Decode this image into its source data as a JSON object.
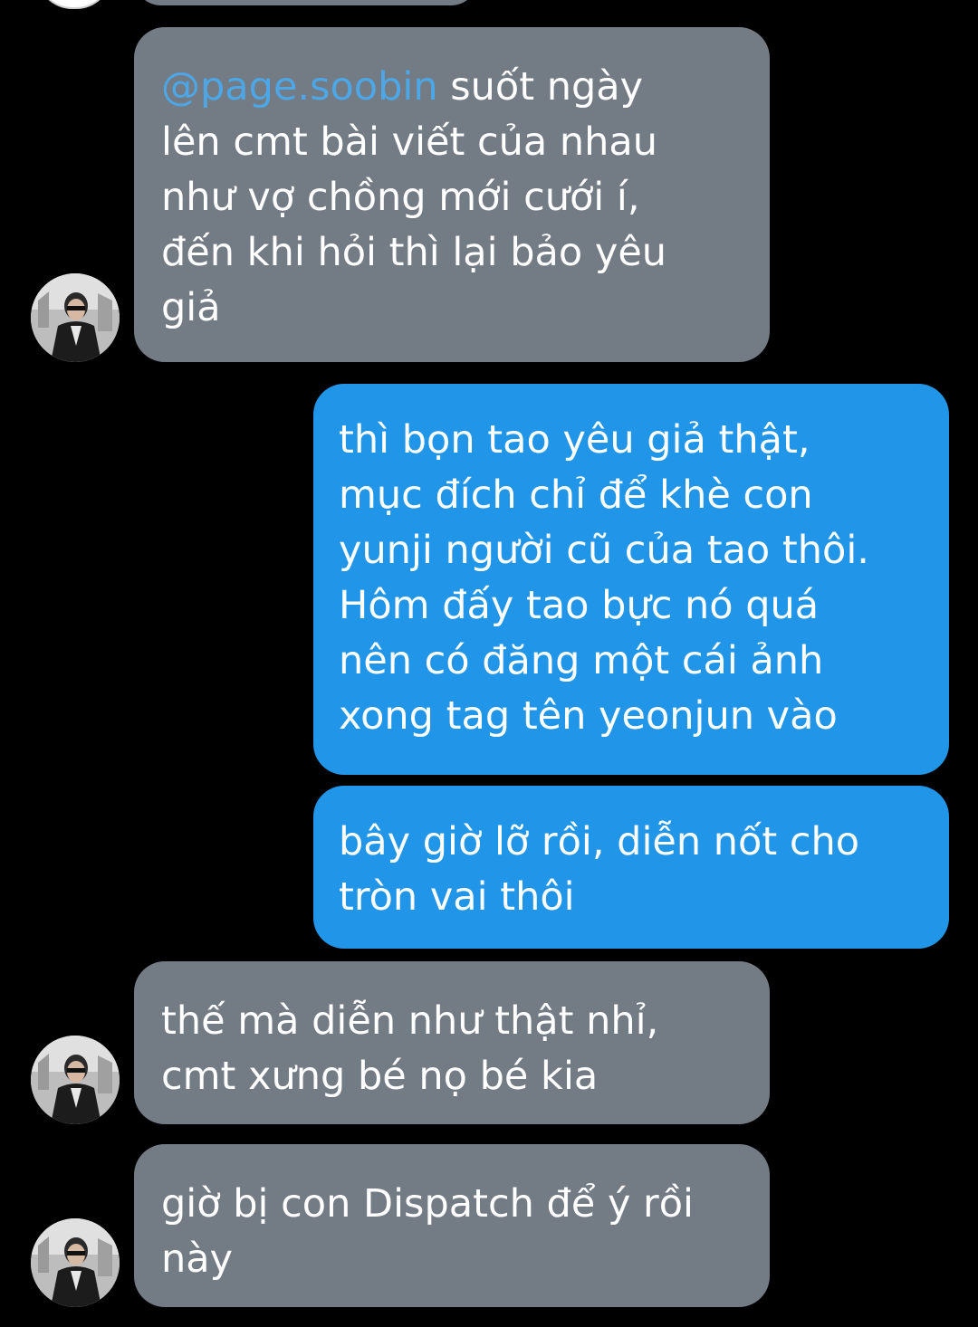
{
  "conversation": {
    "messages": [
      {
        "sender": "other",
        "mention": "@page.soobin",
        "text": " suốt ngày\nlên cmt bài viết của nhau\nnhư vợ chồng mới cưới í,\nđến khi hỏi thì lại bảo yêu\ngiả"
      },
      {
        "sender": "me",
        "text": "thì bọn tao yêu giả thật,\nmục đích chỉ để khè con\nyunji người cũ của tao thôi.\nHôm đấy tao bực nó quá\nnên có đăng một cái ảnh\nxong tag tên yeonjun vào"
      },
      {
        "sender": "me",
        "text": "bây giờ lỡ rồi, diễn nốt cho\ntròn vai thôi"
      },
      {
        "sender": "other",
        "text": "thế mà diễn như thật nhỉ,\ncmt xưng bé nọ bé kia"
      },
      {
        "sender": "other",
        "text": "giờ bị con Dispatch để ý rồi\nnày"
      }
    ]
  },
  "colors": {
    "background": "#000000",
    "incoming_bubble": "#737b84",
    "outgoing_bubble": "#2196e8",
    "mention": "#4da6e6",
    "text": "#ffffff"
  },
  "icons": {
    "avatar": "profile-photo-avatar"
  }
}
